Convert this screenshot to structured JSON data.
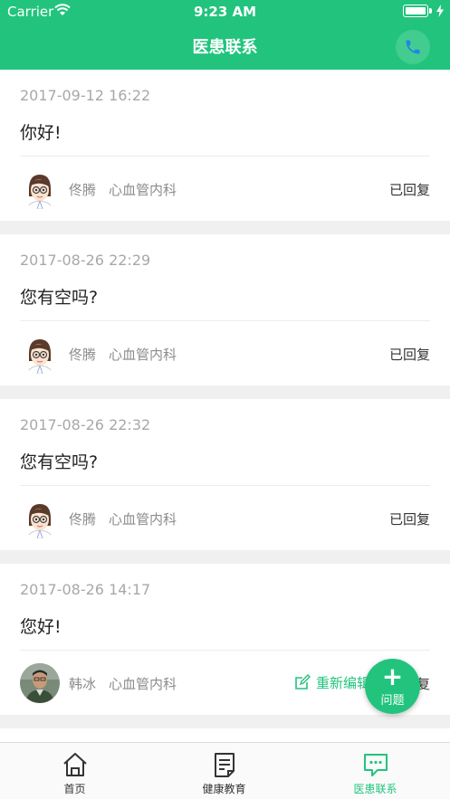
{
  "status_bar": {
    "carrier": "Carrier",
    "time": "9:23 AM"
  },
  "nav": {
    "title": "医患联系"
  },
  "messages": [
    {
      "time": "2017-09-12 16:22",
      "text": "你好!",
      "doctor": "佟腾",
      "dept": "心血管内科",
      "status": "已回复",
      "avatar": "cartoon-doctor"
    },
    {
      "time": "2017-08-26 22:29",
      "text": "您有空吗?",
      "doctor": "佟腾",
      "dept": "心血管内科",
      "status": "已回复",
      "avatar": "cartoon-doctor"
    },
    {
      "time": "2017-08-26 22:32",
      "text": "您有空吗?",
      "doctor": "佟腾",
      "dept": "心血管内科",
      "status": "已回复",
      "avatar": "cartoon-doctor"
    },
    {
      "time": "2017-08-26 14:17",
      "text": "您好!",
      "doctor": "韩冰",
      "dept": "心血管内科",
      "status": "已回复",
      "avatar": "photo",
      "edit_label": "重新编辑"
    }
  ],
  "fab": {
    "plus": "+",
    "label": "问题"
  },
  "tabs": [
    {
      "label": "首页",
      "icon": "home-icon"
    },
    {
      "label": "健康教育",
      "icon": "document-icon"
    },
    {
      "label": "医患联系",
      "icon": "chat-icon",
      "active": true
    }
  ],
  "colors": {
    "accent": "#22c47d",
    "phone_icon": "#1e88e5"
  }
}
